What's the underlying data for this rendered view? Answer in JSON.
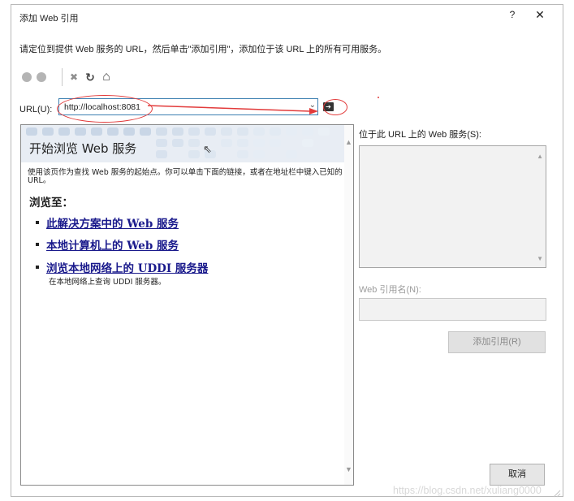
{
  "window": {
    "title": "添加 Web 引用",
    "help_label": "?",
    "close_label": "✕"
  },
  "instruction": "请定位到提供 Web 服务的 URL，然后单击\"添加引用\"，添加位于该 URL 上的所有可用服务。",
  "toolbar": {
    "icons": [
      "back-icon",
      "forward-icon",
      "stop-icon",
      "refresh-icon",
      "home-icon"
    ],
    "stop_glyph": "✖",
    "refresh_glyph": "↻",
    "home_glyph": "⌂"
  },
  "url": {
    "label": "URL(U):",
    "value": "http://localhost:8081",
    "dropdown_glyph": "⌄",
    "go_glyph": "➔"
  },
  "browser": {
    "title": "开始浏览 Web 服务",
    "description": "使用该页作为查找 Web 服务的起始点。你可以单击下面的链接，或者在地址栏中键入已知的 URL。",
    "browse_heading": "浏览至：",
    "links": [
      "此解决方案中的 Web 服务",
      "本地计算机上的 Web 服务",
      "浏览本地网络上的 UDDI 服务器"
    ],
    "uddi_sub": "在本地网络上查询 UDDI 服务器。",
    "scroll_up": "▲",
    "scroll_down": "▼"
  },
  "services": {
    "label": "位于此 URL 上的 Web 服务(S):",
    "scroll_up": "▲",
    "scroll_down": "▼"
  },
  "reference_name": {
    "label": "Web 引用名(N):",
    "value": ""
  },
  "buttons": {
    "add_reference": "添加引用(R)",
    "cancel": "取消"
  },
  "watermark": "https://blog.csdn.net/xuliang0000",
  "colors": {
    "accent": "#3c7fb1",
    "annotation": "#e23b3b",
    "link": "#1a1a8c"
  }
}
